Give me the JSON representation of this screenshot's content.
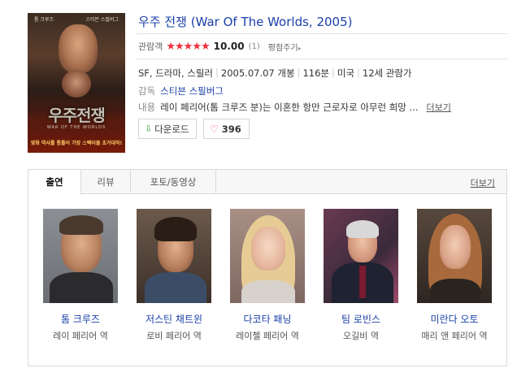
{
  "poster": {
    "top_left": "톰 크루즈",
    "top_right": "스티븐 스필버그",
    "title": "우주전쟁",
    "subtitle": "WAR OF THE WORLDS",
    "tagline": "영화 역사를 통틀어 가장 스펙터클 초거대작!"
  },
  "movie": {
    "title": "우주 전쟁 (War Of The Worlds, 2005)",
    "rating_label": "관람객",
    "stars": "★★★★★",
    "score": "10.00",
    "count": "(1)",
    "rate_link": "평점주기",
    "genre": "SF, 드라마, 스릴러",
    "release": "2005.07.07 개봉",
    "runtime": "116분",
    "country": "미국",
    "age_rating": "12세 관람가",
    "director_label": "감독",
    "director": "스티븐 스필버그",
    "plot_label": "내용",
    "plot": "레이 페리어(톰 크루즈 분)는 이혼한 항만 근로자로 아무런 희망 ...",
    "plot_more": "더보기"
  },
  "buttons": {
    "download": "다운로드",
    "like_count": "396"
  },
  "tabs": [
    {
      "label": "출연"
    },
    {
      "label": "리뷰"
    },
    {
      "label": "포토/동영상"
    }
  ],
  "cast_more": "더보기",
  "cast": [
    {
      "name": "톰 크루즈",
      "role": "레이 페리어 역"
    },
    {
      "name": "저스틴 채트윈",
      "role": "로비 페리어 역"
    },
    {
      "name": "다코타 패닝",
      "role": "레이첼 페리어 역"
    },
    {
      "name": "팀 로빈스",
      "role": "오길비 역"
    },
    {
      "name": "미란다 오토",
      "role": "매리 앤 페리어 역"
    }
  ],
  "colors": {
    "link_blue": "#1a3fa8",
    "star_red": "#f0303c",
    "download_green": "#3b9a35",
    "heart_red": "#e0454e"
  }
}
